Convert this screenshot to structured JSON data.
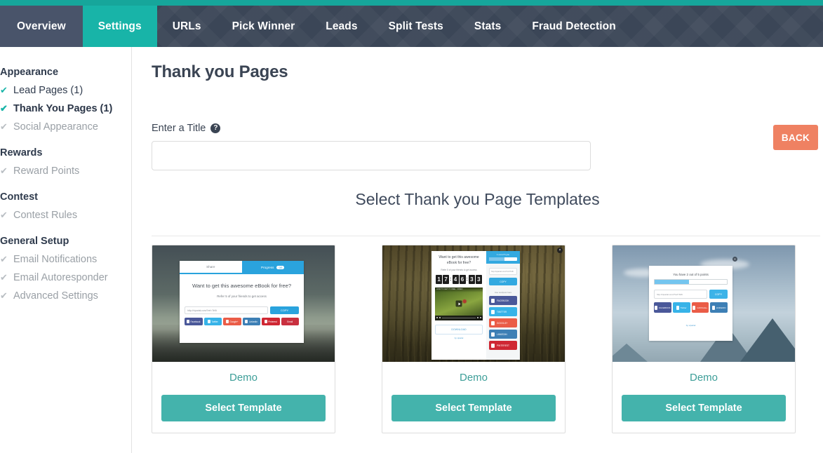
{
  "nav": {
    "items": [
      {
        "label": "Overview",
        "active": false
      },
      {
        "label": "Settings",
        "active": true
      },
      {
        "label": "URLs",
        "active": false
      },
      {
        "label": "Pick Winner",
        "active": false
      },
      {
        "label": "Leads",
        "active": false
      },
      {
        "label": "Split Tests",
        "active": false
      },
      {
        "label": "Stats",
        "active": false
      },
      {
        "label": "Fraud Detection",
        "active": false
      }
    ],
    "accent_color": "#16a69b",
    "bar_color": "#3b4657"
  },
  "sidebar": {
    "groups": [
      {
        "title": "Appearance",
        "items": [
          {
            "label": "Lead Pages (1)",
            "state": "done"
          },
          {
            "label": "Thank You Pages (1)",
            "state": "current"
          },
          {
            "label": "Social Appearance",
            "state": "todo"
          }
        ]
      },
      {
        "title": "Rewards",
        "items": [
          {
            "label": "Reward Points",
            "state": "todo"
          }
        ]
      },
      {
        "title": "Contest",
        "items": [
          {
            "label": "Contest Rules",
            "state": "todo"
          }
        ]
      },
      {
        "title": "General Setup",
        "items": [
          {
            "label": "Email Notifications",
            "state": "todo"
          },
          {
            "label": "Email Autoresponder",
            "state": "todo"
          },
          {
            "label": "Advanced Settings",
            "state": "todo"
          }
        ]
      }
    ],
    "check_glyph": "✔"
  },
  "main": {
    "page_title": "Thank you Pages",
    "back_button": "BACK",
    "field_label": "Enter a Title",
    "help_glyph": "?",
    "title_input_value": "",
    "title_input_placeholder": "",
    "section_heading": "Select Thank you Page Templates"
  },
  "templates": [
    {
      "demo_label": "Demo",
      "select_label": "Select Template",
      "preview": {
        "tab_share": "Share",
        "tab_progress": "Progress",
        "progress_pill": "0/5",
        "headline": "Want to get this awesome eBook for free?",
        "subline": "Refer 5 of your friends to get access",
        "url": "http://viparial.com/?ref=Te5t",
        "copy_label": "COPY",
        "social": [
          {
            "label": "Facebook",
            "color": "#4a5899"
          },
          {
            "label": "Twitter",
            "color": "#37b3e8"
          },
          {
            "label": "Google+",
            "color": "#ea5c47"
          },
          {
            "label": "LinkedIn",
            "color": "#3d7fb5"
          },
          {
            "label": "Pinterest",
            "color": "#cf2733"
          },
          {
            "label": "Email",
            "color": "#c9303f"
          }
        ]
      }
    },
    {
      "demo_label": "Demo",
      "select_label": "Select Template",
      "preview": {
        "headline": "Want to get this awesome eBook for free?",
        "subline": "Refer 5 of your friends to get access",
        "countdown": "17:46:33",
        "countdown_digits": [
          "1",
          "7",
          "4",
          "6",
          "3",
          "3"
        ],
        "video_title": "HOW TO GET IT FREE - VIDEO",
        "download_label": "DOWNLOAD",
        "powered_by": "by viparial",
        "progress_title": "1 out of 5 you",
        "progress_percent": 55,
        "url": "http://viparial.com/?ref=Te5t",
        "copy_label": "COPY",
        "share_label": "Use text/post here",
        "social": [
          {
            "label": "FACEBOOK",
            "color": "#4a5899"
          },
          {
            "label": "TWITTER",
            "color": "#37b3e8"
          },
          {
            "label": "GOOGLE+",
            "color": "#ea5c47"
          },
          {
            "label": "LINKEDIN",
            "color": "#3d7fb5"
          },
          {
            "label": "PINTEREST",
            "color": "#cf2733"
          }
        ],
        "close_glyph": "×"
      }
    },
    {
      "demo_label": "Demo",
      "select_label": "Select Template",
      "preview": {
        "headline": "You have 2 out of 5 points",
        "progress_percent": 48,
        "url": "http://viparial.com/?ref=Te5t",
        "copy_label": "COPY",
        "social": [
          {
            "label": "FACEBOOK",
            "color": "#4a5899"
          },
          {
            "label": "Twitter",
            "color": "#37b3e8"
          },
          {
            "label": "GOOGLE+",
            "color": "#ea5c47"
          },
          {
            "label": "LINKEDIN",
            "color": "#3d7fb5"
          }
        ],
        "powered_by": "by viparial",
        "close_glyph": "×"
      }
    }
  ],
  "colors": {
    "teal": "#18b4a8",
    "button_teal": "#44b3ac",
    "back_orange": "#ef8162",
    "dark_navy": "#3b4657",
    "demo_link": "#3d9e98"
  }
}
